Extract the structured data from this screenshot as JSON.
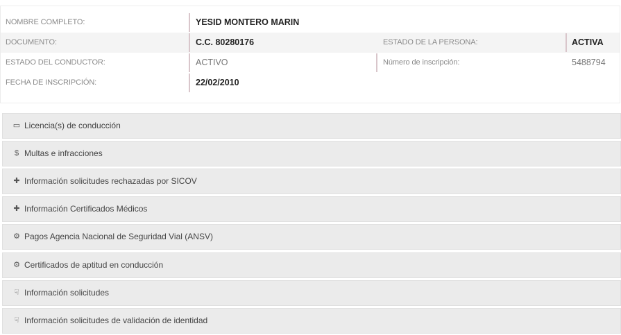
{
  "person": {
    "nombre_label": "NOMBRE COMPLETO:",
    "nombre_value": "YESID MONTERO MARIN",
    "documento_label": "DOCUMENTO:",
    "documento_value": "C.C. 80280176",
    "estado_persona_label": "ESTADO DE LA PERSONA:",
    "estado_persona_value": "ACTIVA",
    "estado_conductor_label": "ESTADO DEL CONDUCTOR:",
    "estado_conductor_value": "ACTIVO",
    "numero_inscripcion_label": "Número de inscripción:",
    "numero_inscripcion_value": "5488794",
    "fecha_inscripcion_label": "FECHA DE INSCRIPCIÓN:",
    "fecha_inscripcion_value": "22/02/2010"
  },
  "sections": [
    {
      "icon": "license-card-icon",
      "glyph": "▭",
      "label": "Licencia(s) de conducción"
    },
    {
      "icon": "dollar-icon",
      "glyph": "$",
      "label": "Multas e infracciones"
    },
    {
      "icon": "medical-cross-icon",
      "glyph": "✚",
      "label": "Información solicitudes rechazadas por SICOV"
    },
    {
      "icon": "medical-cross-icon",
      "glyph": "✚",
      "label": "Información Certificados Médicos"
    },
    {
      "icon": "certificate-seal-icon",
      "glyph": "⚙",
      "label": "Pagos Agencia Nacional de Seguridad Vial (ANSV)"
    },
    {
      "icon": "certificate-seal-icon",
      "glyph": "⚙",
      "label": "Certificados de aptitud en conducción"
    },
    {
      "icon": "hand-pointer-icon",
      "glyph": "☟",
      "label": "Información solicitudes"
    },
    {
      "icon": "hand-pointer-icon",
      "glyph": "☟",
      "label": "Información solicitudes de validación de identidad"
    }
  ]
}
